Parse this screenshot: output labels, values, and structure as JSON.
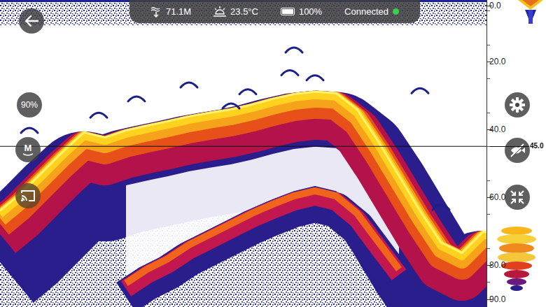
{
  "status_bar": {
    "depth": "71.1M",
    "temperature": "23.5°C",
    "battery": "100%",
    "battery_level": 1,
    "connection": "Connected",
    "connected": true
  },
  "left_buttons": {
    "sensitivity": "90%",
    "mode": "M"
  },
  "depth_scale": {
    "ticks": [
      {
        "label": "0.0",
        "depth": 0
      },
      {
        "label": "20.0",
        "depth": 20
      },
      {
        "label": "40.0",
        "depth": 40
      },
      {
        "label": "60.0",
        "depth": 60
      },
      {
        "label": "80.0",
        "depth": 80
      },
      {
        "label": "90.0",
        "depth": 90
      }
    ],
    "cursor": "45.0",
    "cursor_depth": 45
  },
  "sonar": {
    "bottom": [
      63.7,
      58.6,
      52.4,
      46.2,
      40.6,
      42.1,
      40.0,
      38.6,
      37.3,
      35.9,
      34.8,
      33.8,
      32.4,
      30.7,
      29.3,
      28.6,
      29.0,
      33.8,
      43.1,
      53.4,
      63.7,
      73.0,
      76.1,
      69.9
    ],
    "second_echo": {
      "start": 6,
      "depths": [
        84.3,
        80.2,
        77.1,
        73.0,
        69.9,
        66.8,
        63.7,
        61.0,
        58.6,
        57.1,
        58.6,
        63.7,
        72.0,
        80.2
      ]
    },
    "fish": [
      {
        "ping": 1.4,
        "depth": 40.0
      },
      {
        "ping": 4.7,
        "depth": 35.5
      },
      {
        "ping": 6.5,
        "depth": 30.7
      },
      {
        "ping": 9.0,
        "depth": 26.6
      },
      {
        "ping": 11.0,
        "depth": 32.8
      },
      {
        "ping": 11.8,
        "depth": 28.6
      },
      {
        "ping": 13.8,
        "depth": 23.0
      },
      {
        "ping": 14.0,
        "depth": 16.3
      },
      {
        "ping": 15.0,
        "depth": 24.5
      },
      {
        "ping": 20.0,
        "depth": 28.3
      },
      {
        "ping": 21.0,
        "depth": 62.7
      }
    ]
  }
}
